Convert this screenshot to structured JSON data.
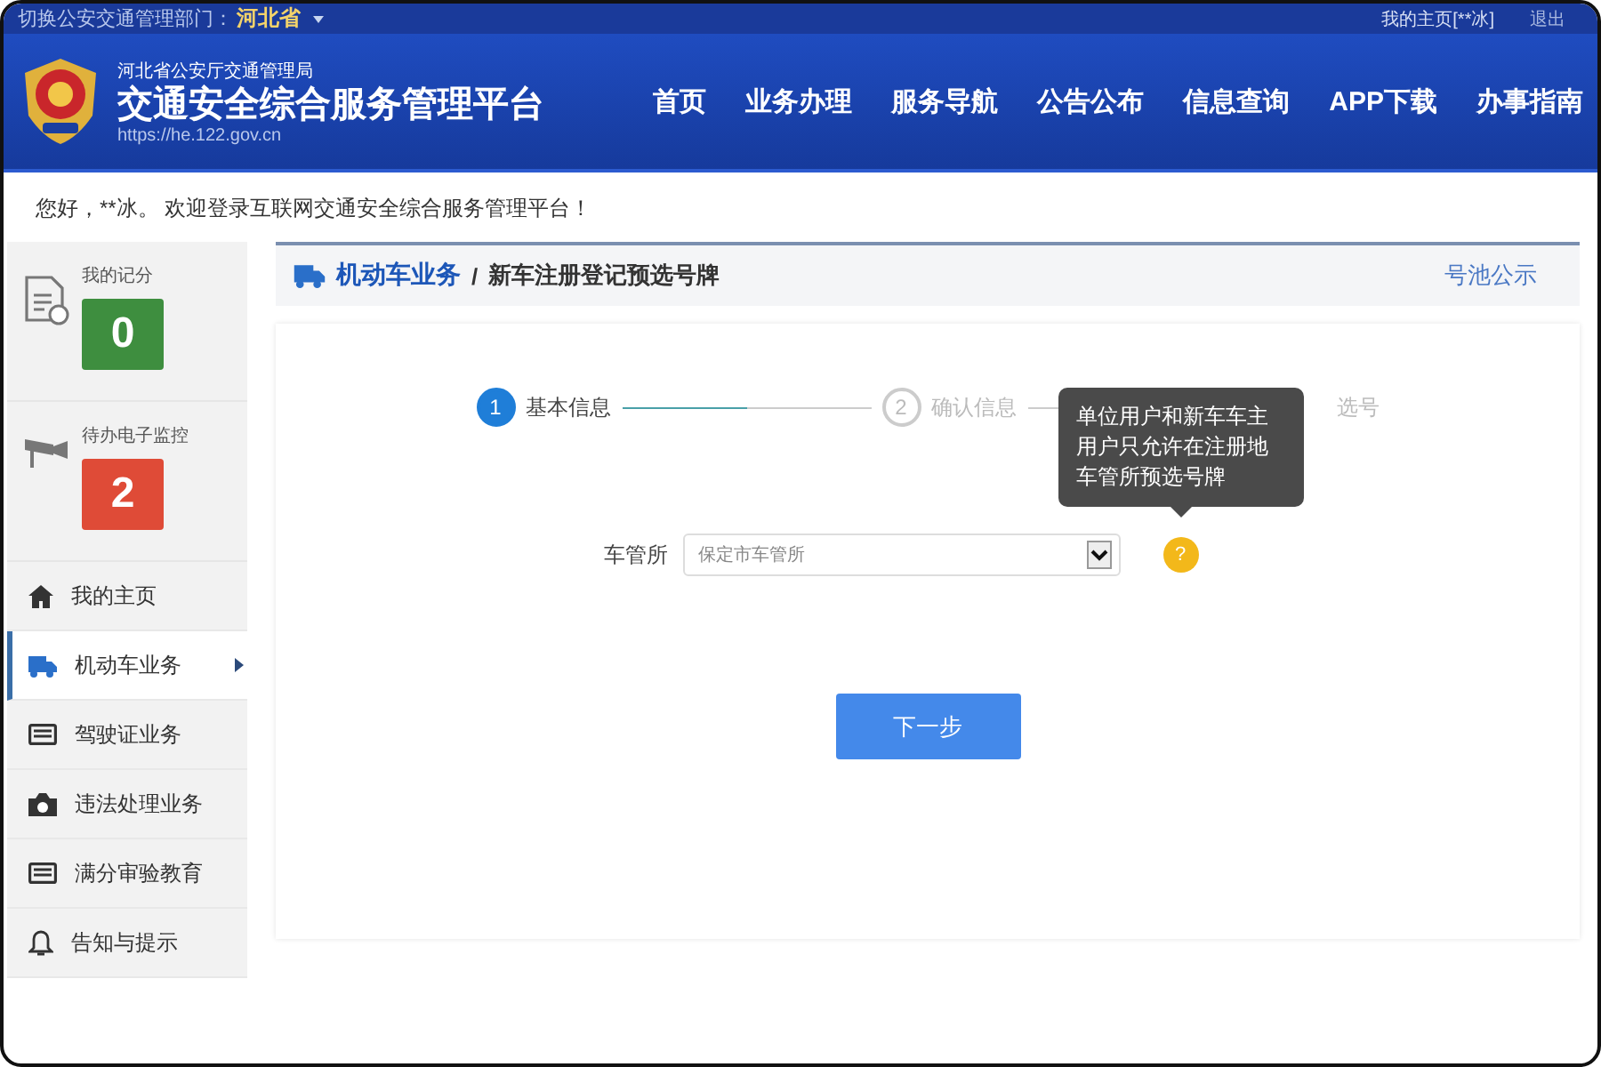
{
  "top_bar": {
    "switch_label": "切换公安交通管理部门：",
    "province": "河北省",
    "my_home": "我的主页[**冰]",
    "logout": "退出"
  },
  "header": {
    "org": "河北省公安厅交通管理局",
    "title": "交通安全综合服务管理平台",
    "url": "https://he.122.gov.cn",
    "nav": [
      "首页",
      "业务办理",
      "服务导航",
      "公告公布",
      "信息查询",
      "APP下载",
      "办事指南"
    ]
  },
  "welcome": "您好，**冰。 欢迎登录互联网交通安全综合服务管理平台！",
  "stats": [
    {
      "label": "我的记分",
      "value": "0",
      "color": "#3e8e3f",
      "kind": "document"
    },
    {
      "label": "待办电子监控",
      "value": "2",
      "color": "#df4b37",
      "kind": "camera-pole"
    }
  ],
  "sidebar": {
    "items": [
      {
        "label": "我的主页",
        "kind": "home",
        "selected": false
      },
      {
        "label": "机动车业务",
        "kind": "truck",
        "selected": true
      },
      {
        "label": "驾驶证业务",
        "kind": "card",
        "selected": false
      },
      {
        "label": "违法处理业务",
        "kind": "camera",
        "selected": false
      },
      {
        "label": "满分审验教育",
        "kind": "card",
        "selected": false
      },
      {
        "label": "告知与提示",
        "kind": "bell",
        "selected": false
      }
    ]
  },
  "breadcrumb": {
    "section": "机动车业务",
    "separator": "/",
    "page": "新车注册登记预选号牌",
    "link": "号池公示"
  },
  "steps": [
    {
      "number": "1",
      "label": "基本信息",
      "active": true
    },
    {
      "number": "2",
      "label": "确认信息",
      "active": false
    },
    {
      "label": "选号",
      "active": false
    }
  ],
  "tooltip": "单位用户和新车车主用户只允许在注册地车管所预选号牌",
  "form": {
    "label": "车管所",
    "value": "保定市车管所",
    "help": "?"
  },
  "next_button": "下一步"
}
